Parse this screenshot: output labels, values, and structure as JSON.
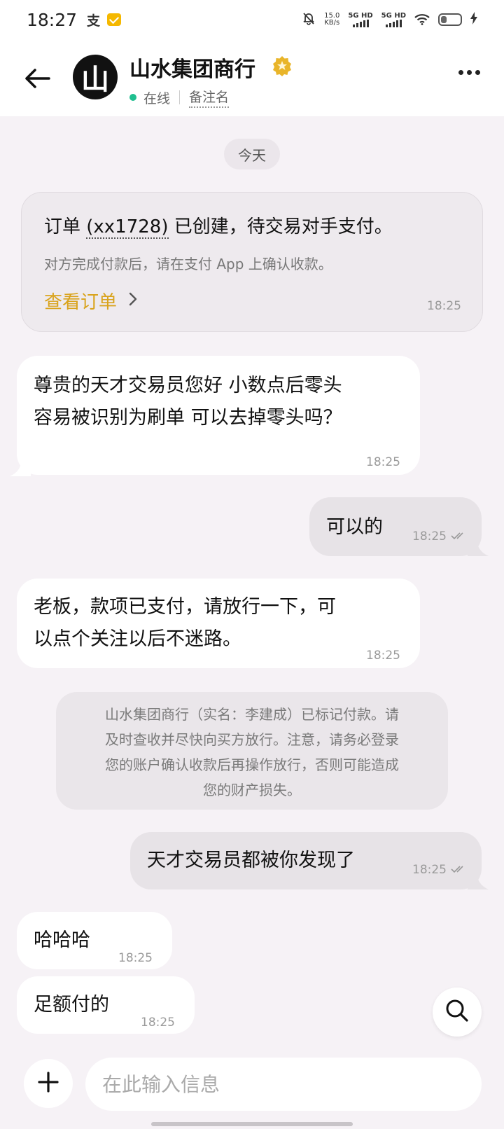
{
  "status_bar": {
    "time": "18:27",
    "alipay_glyph": "支",
    "speed_value": "15.0",
    "speed_unit": "KB/s",
    "signal1": "5G HD",
    "signal2": "5G HD",
    "battery_level": 0.3
  },
  "header": {
    "avatar_text": "山",
    "shop_name": "山水集团商行",
    "online": "在线",
    "remark": "备注名"
  },
  "chat": {
    "date_label": "今天",
    "order": {
      "title_pre": "订单 ",
      "order_id": "(xx1728)",
      "title_post": " 已创建，待交易对手支付。",
      "subtitle": "对方完成付款后，请在支付 App 上确认收款。",
      "link": "查看订单",
      "time": "18:25"
    },
    "messages": [
      {
        "dir": "in",
        "line1": "尊贵的天才交易员您好 小数点后零头",
        "line2": "容易被识别为刷单 可以去掉零头吗？",
        "time": "18:25"
      },
      {
        "dir": "out",
        "text": "可以的",
        "time": "18:25"
      },
      {
        "dir": "in",
        "line1": "老板，款项已支付，请放行一下，可",
        "line2": "以点个关注以后不迷路。",
        "time": "18:25"
      },
      {
        "dir": "out",
        "text": "天才交易员都被你发现了",
        "time": "18:25"
      },
      {
        "dir": "in",
        "text": "哈哈哈",
        "time": "18:25"
      },
      {
        "dir": "in",
        "text": "足额付的",
        "time": "18:25"
      }
    ],
    "system_note": {
      "line1": "山水集团商行（实名：李建成）已标记付款。请",
      "line2": "及时查收并尽快向买方放行。注意，请务必登录",
      "line3": "您的账户确认收款后再操作放行，否则可能造成",
      "line4": "您的财产损失。"
    }
  },
  "composer": {
    "placeholder": "在此输入信息"
  },
  "icons": {
    "back": "back-arrow-icon",
    "verified": "verified-badge-icon",
    "more": "more-dots-icon",
    "search": "search-icon",
    "plus": "plus-icon",
    "read": "double-check-icon"
  },
  "colors": {
    "accent_link": "#d9a31c",
    "online": "#1fbf8f",
    "chat_bg": "#f6f2f6"
  }
}
